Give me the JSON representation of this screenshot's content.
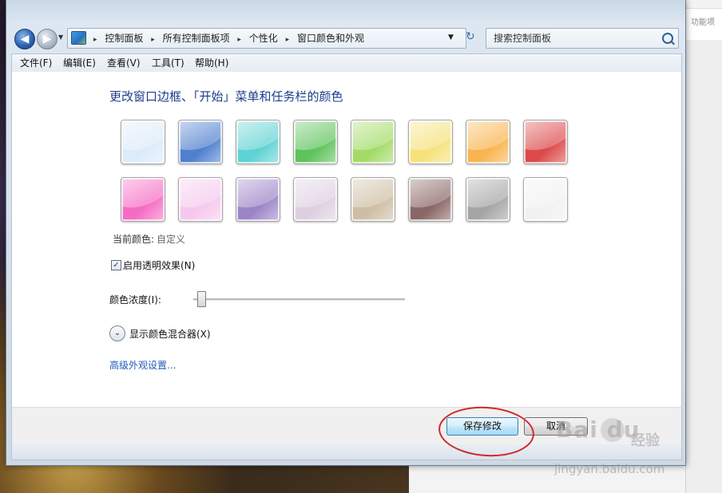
{
  "background": {
    "right_window_snippet": "功能项"
  },
  "nav": {
    "back_glyph": "◀",
    "forward_glyph": "▶",
    "dropdown_glyph": "▼",
    "breadcrumbs": [
      "控制面板",
      "所有控制面板项",
      "个性化",
      "窗口颜色和外观"
    ],
    "separator": "▸",
    "address_dropdown_glyph": "▼",
    "refresh_glyph": "↻",
    "search_placeholder": "搜索控制面板"
  },
  "menu": {
    "items": [
      "文件(F)",
      "编辑(E)",
      "查看(V)",
      "工具(T)",
      "帮助(H)"
    ]
  },
  "content": {
    "title": "更改窗口边框、「开始」菜单和任务栏的颜色",
    "swatches": [
      {
        "color": "#dcebfa"
      },
      {
        "color": "#4f7fcf"
      },
      {
        "color": "#5fd2d3"
      },
      {
        "color": "#5fc35c"
      },
      {
        "color": "#a3db66"
      },
      {
        "color": "#f5e27a"
      },
      {
        "color": "#f9b34f"
      },
      {
        "color": "#dc4a4a"
      },
      {
        "color": "#f56cc4"
      },
      {
        "color": "#f6c8ee"
      },
      {
        "color": "#9c84c7"
      },
      {
        "color": "#ddcfe0"
      },
      {
        "color": "#cdbea4"
      },
      {
        "color": "#8a6766"
      },
      {
        "color": "#a5a5a7"
      },
      {
        "color": "#f1f1f1"
      }
    ],
    "current_color_label": "当前颜色:",
    "current_color_value": "自定义",
    "transparency_label": "启用透明效果(N)",
    "transparency_checked": true,
    "checkmark_glyph": "✓",
    "intensity_label": "颜色浓度(I):",
    "intensity_value": 0.02,
    "mixer_glyph": "⌄",
    "mixer_label": "显示颜色混合器(X)",
    "advanced_link": "高级外观设置..."
  },
  "footer": {
    "save_label": "保存修改",
    "cancel_label": "取消"
  },
  "watermark": {
    "brand": "Bai  du",
    "brand_cn": "经验",
    "url": "jingyan.baidu.com"
  },
  "colors": {
    "title_blue": "#1e3c8c",
    "link_blue": "#1f5bb5",
    "annotation_red": "#d0282c"
  }
}
